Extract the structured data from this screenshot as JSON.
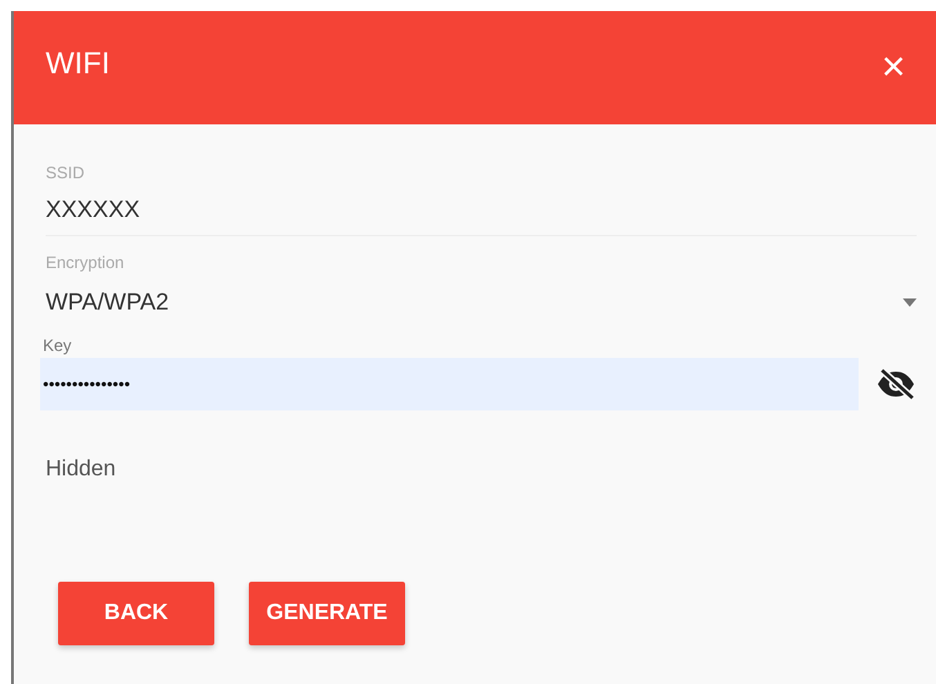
{
  "dialog": {
    "title": "WIFI",
    "close": "×"
  },
  "fields": [
    {
      "kind": "text",
      "label": "SSID",
      "value": "XXXXXX"
    },
    {
      "kind": "select",
      "label": "Encryption",
      "value": "WPA/WPA2"
    },
    {
      "kind": "password",
      "label": "Key",
      "value": "•••••••••••••••"
    }
  ],
  "hidden_label": "Hidden",
  "buttons": [
    "BACK",
    "GENERATE"
  ]
}
